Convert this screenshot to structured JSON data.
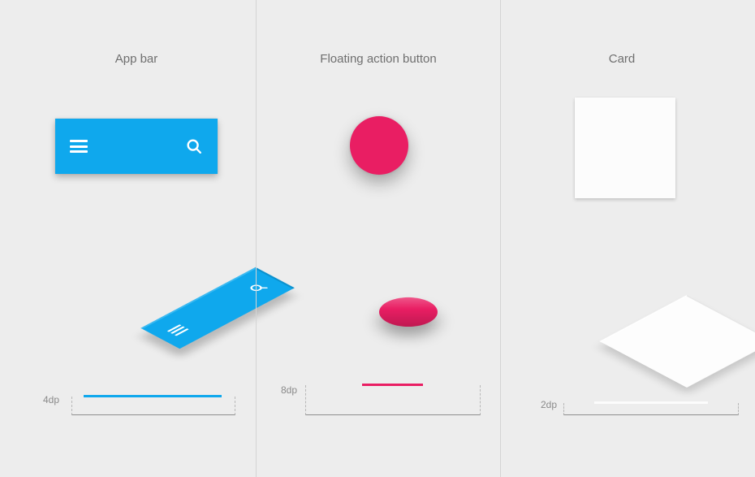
{
  "columns": {
    "appbar": {
      "title": "App bar",
      "elevation_label": "4dp",
      "color": "#0FA8ED",
      "icons": {
        "left": "hamburger-icon",
        "right": "search-icon"
      }
    },
    "fab": {
      "title": "Floating action button",
      "elevation_label": "8dp",
      "color": "#E91E63"
    },
    "card": {
      "title": "Card",
      "elevation_label": "2dp",
      "color": "#FCFCFC"
    }
  }
}
